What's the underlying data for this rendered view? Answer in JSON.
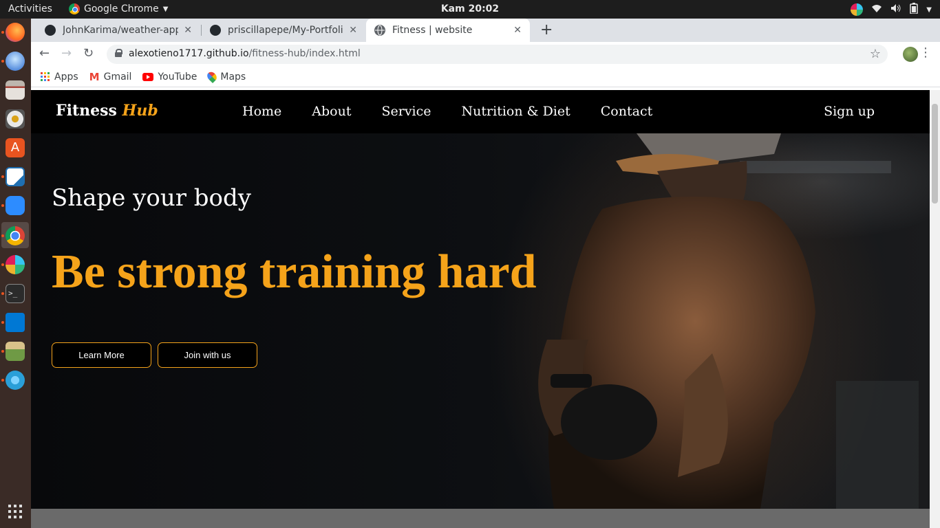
{
  "system": {
    "activities": "Activities",
    "app_name": "Google Chrome",
    "clock": "Kam 20:02"
  },
  "browser": {
    "tabs": [
      {
        "title": "JohnKarima/weather-app",
        "icon": "github-icon"
      },
      {
        "title": "priscillapepe/My-Portfolio",
        "icon": "github-icon"
      },
      {
        "title": "Fitness | website",
        "icon": "globe-icon",
        "active": true
      }
    ],
    "url_host": "alexotieno1717.github.io",
    "url_path": "/fitness-hub/index.html",
    "bookmarks": [
      {
        "label": "Apps",
        "icon": "apps-grid-icon"
      },
      {
        "label": "Gmail",
        "icon": "gmail-icon"
      },
      {
        "label": "YouTube",
        "icon": "youtube-icon"
      },
      {
        "label": "Maps",
        "icon": "maps-icon"
      }
    ]
  },
  "site": {
    "logo_main": "Fitness",
    "logo_accent": "Hub",
    "nav": [
      "Home",
      "About",
      "Service",
      "Nutrition & Diet",
      "Contact"
    ],
    "signup": "Sign up",
    "hero": {
      "subtitle": "Shape your body",
      "title": "Be strong training hard",
      "buttons": [
        "Learn More",
        "Join with us"
      ]
    },
    "accent_color": "#f5a31a"
  }
}
